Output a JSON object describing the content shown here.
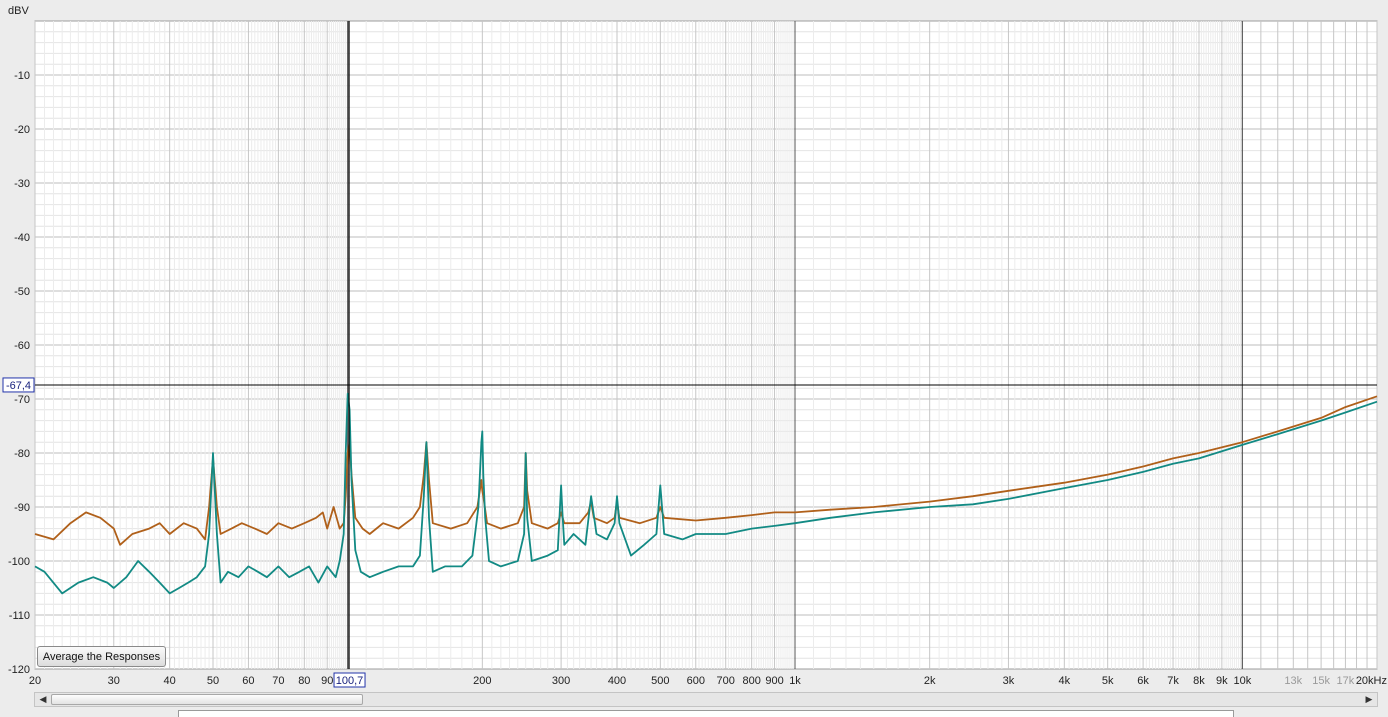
{
  "chart_data": {
    "type": "line",
    "ylabel": "dBV",
    "ylim": [
      -120,
      0
    ],
    "xlim": [
      20,
      20000
    ],
    "x_scale": "log",
    "grid": true,
    "y_ticks": [
      "-10",
      "-20",
      "-30",
      "-40",
      "-50",
      "-60",
      "-70",
      "-80",
      "-90",
      "-100",
      "-110",
      "-120"
    ],
    "x_ticks": [
      {
        "value": 20,
        "label": "20"
      },
      {
        "value": 30,
        "label": "30"
      },
      {
        "value": 40,
        "label": "40"
      },
      {
        "value": 50,
        "label": "50"
      },
      {
        "value": 60,
        "label": "60"
      },
      {
        "value": 70,
        "label": "70"
      },
      {
        "value": 80,
        "label": "80"
      },
      {
        "value": 90,
        "label": "90"
      },
      {
        "value": 200,
        "label": "200"
      },
      {
        "value": 300,
        "label": "300"
      },
      {
        "value": 400,
        "label": "400"
      },
      {
        "value": 500,
        "label": "500"
      },
      {
        "value": 600,
        "label": "600"
      },
      {
        "value": 700,
        "label": "700"
      },
      {
        "value": 800,
        "label": "800"
      },
      {
        "value": 900,
        "label": "900"
      },
      {
        "value": 1000,
        "label": "1k"
      },
      {
        "value": 2000,
        "label": "2k"
      },
      {
        "value": 3000,
        "label": "3k"
      },
      {
        "value": 4000,
        "label": "4k"
      },
      {
        "value": 5000,
        "label": "5k"
      },
      {
        "value": 6000,
        "label": "6k"
      },
      {
        "value": 7000,
        "label": "7k"
      },
      {
        "value": 8000,
        "label": "8k"
      },
      {
        "value": 9000,
        "label": "9k"
      },
      {
        "value": 10000,
        "label": "10k"
      },
      {
        "value": 13000,
        "label": "13k"
      },
      {
        "value": 15000,
        "label": "15k"
      },
      {
        "value": 17000,
        "label": "17k"
      },
      {
        "value": 20000,
        "label": "20kHz"
      }
    ],
    "cursor": {
      "x": 100.7,
      "y": -67.4,
      "x_label": "100,7",
      "y_label": "-67,4"
    },
    "series": [
      {
        "color": "#b0601a",
        "x": [
          20,
          22,
          24,
          26,
          28,
          30,
          31,
          33,
          36,
          38,
          40,
          43,
          46,
          48,
          49,
          50,
          51,
          52,
          55,
          58,
          62,
          66,
          70,
          75,
          80,
          85,
          88,
          90,
          93,
          96,
          98,
          99,
          100,
          101,
          102,
          104,
          108,
          112,
          120,
          130,
          140,
          145,
          148,
          150,
          152,
          155,
          170,
          185,
          195,
          199,
          200,
          201,
          205,
          220,
          240,
          248,
          250,
          252,
          258,
          280,
          295,
          300,
          305,
          330,
          345,
          350,
          355,
          380,
          395,
          400,
          405,
          450,
          490,
          500,
          510,
          600,
          700,
          800,
          900,
          1000,
          1200,
          1500,
          2000,
          2500,
          3000,
          4000,
          5000,
          6000,
          7000,
          8000,
          10000,
          12000,
          15000,
          17000,
          20000
        ],
        "y": [
          -95,
          -96,
          -93,
          -91,
          -92,
          -94,
          -97,
          -95,
          -94,
          -93,
          -95,
          -93,
          -94,
          -96,
          -90,
          -81,
          -90,
          -95,
          -94,
          -93,
          -94,
          -95,
          -93,
          -94,
          -93,
          -92,
          -91,
          -94,
          -90,
          -94,
          -93,
          -88,
          -80,
          -78,
          -84,
          -92,
          -94,
          -95,
          -93,
          -94,
          -92,
          -90,
          -84,
          -78,
          -85,
          -93,
          -94,
          -93,
          -90,
          -85,
          -87,
          -88,
          -93,
          -94,
          -93,
          -90,
          -80,
          -87,
          -93,
          -94,
          -93,
          -91,
          -93,
          -93,
          -91,
          -89,
          -92,
          -93,
          -92,
          -89,
          -92,
          -93,
          -92,
          -90,
          -92,
          -92.5,
          -92,
          -91.5,
          -91,
          -91,
          -90.5,
          -90,
          -89,
          -88,
          -87,
          -85.5,
          -84,
          -82.5,
          -81,
          -80,
          -78,
          -76,
          -73.5,
          -71.5,
          -69.5
        ]
      },
      {
        "color": "#128a84",
        "x": [
          20,
          21,
          23,
          25,
          27,
          29,
          30,
          32,
          34,
          36,
          38,
          40,
          42,
          44,
          46,
          48,
          49,
          50,
          51,
          52,
          54,
          57,
          60,
          63,
          66,
          70,
          74,
          78,
          82,
          86,
          90,
          94,
          96,
          98,
          99,
          100,
          101,
          102,
          104,
          107,
          112,
          120,
          130,
          140,
          145,
          148,
          150,
          152,
          155,
          165,
          180,
          190,
          196,
          199,
          200,
          201,
          203,
          207,
          220,
          240,
          248,
          250,
          252,
          258,
          280,
          295,
          300,
          302,
          305,
          320,
          340,
          350,
          360,
          380,
          395,
          400,
          405,
          430,
          460,
          490,
          500,
          510,
          560,
          600,
          700,
          800,
          900,
          1000,
          1200,
          1500,
          2000,
          2500,
          3000,
          4000,
          5000,
          6000,
          7000,
          8000,
          10000,
          12000,
          15000,
          17000,
          20000
        ],
        "y": [
          -101,
          -102,
          -106,
          -104,
          -103,
          -104,
          -105,
          -103,
          -100,
          -102,
          -104,
          -106,
          -105,
          -104,
          -103,
          -101,
          -95,
          -80,
          -95,
          -104,
          -102,
          -103,
          -101,
          -102,
          -103,
          -101,
          -103,
          -102,
          -101,
          -104,
          -101,
          -103,
          -100,
          -95,
          -80,
          -69,
          -72,
          -85,
          -98,
          -102,
          -103,
          -102,
          -101,
          -101,
          -99,
          -88,
          -78,
          -92,
          -102,
          -101,
          -101,
          -99,
          -90,
          -78,
          -76,
          -84,
          -92,
          -100,
          -101,
          -100,
          -95,
          -80,
          -92,
          -100,
          -99,
          -98,
          -86,
          -91,
          -97,
          -95,
          -97,
          -88,
          -95,
          -96,
          -93,
          -88,
          -93,
          -99,
          -97,
          -95,
          -86,
          -95,
          -96,
          -95,
          -95,
          -94,
          -93.5,
          -93,
          -92,
          -91,
          -90,
          -89.5,
          -88.5,
          -86.5,
          -85,
          -83.5,
          -82,
          -81,
          -78.5,
          -76.5,
          -74,
          -72.5,
          -70.5
        ]
      }
    ]
  },
  "controls": {
    "average_button": "Average the Responses"
  }
}
